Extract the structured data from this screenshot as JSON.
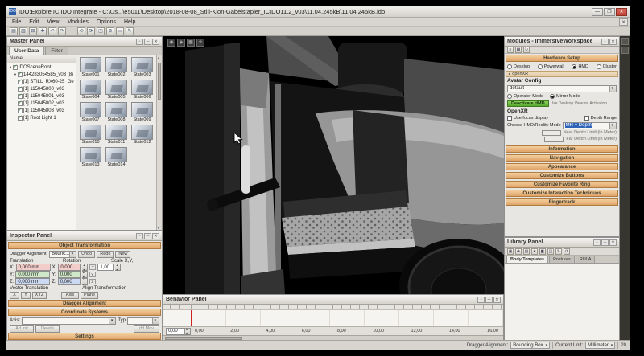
{
  "titlebar": {
    "app_icon": "IDO",
    "title": "IDO:Explore IC.IDO Integrate  -  C:\\Us...\\e5011\\Desktop\\2018-08-08_Still-Kion-Gabelstapler_ICIDO11.2_v03\\11.04.245kB\\11.04.245kB.ido",
    "window_buttons": [
      "—",
      "❐",
      "✕"
    ]
  },
  "menubar": {
    "items": [
      "File",
      "Edit",
      "View",
      "Modules",
      "Options",
      "Help"
    ]
  },
  "toolbar": {
    "icons": [
      "▤",
      "▥",
      "⊞",
      "✚",
      "↶",
      "↷",
      "⟲",
      "⟳",
      "◳",
      "⊕",
      "▭",
      "✎"
    ]
  },
  "master_panel": {
    "title": "Master Panel",
    "tabs": [
      "User Data",
      "Filter"
    ],
    "tree_header": "Name",
    "tree": [
      {
        "label": "IDOSceneRoot"
      },
      {
        "label": "144283054585_v03 (8)"
      },
      {
        "label": "[1] STILL_RX60-25_Ge"
      },
      {
        "label": "[1] 115045800_v03"
      },
      {
        "label": "[1] 115045801_v03"
      },
      {
        "label": "[1] 115045802_v03"
      },
      {
        "label": "[1] 115045803_v03"
      },
      {
        "label": "[1] Root Light 1"
      }
    ],
    "states": [
      "State001",
      "State002",
      "State003",
      "State004",
      "State005",
      "State006",
      "State007",
      "State008",
      "State009",
      "State010",
      "State011",
      "State012",
      "State013",
      "State014"
    ]
  },
  "inspector_panel": {
    "title": "Inspector Panel",
    "section_object_transformation": "Object Transformation",
    "dragger_alignment_label": "Dragger Alignment:",
    "dragger_alignment_value": "Bounc...",
    "undo": "Undo",
    "redo": "Redo",
    "new": "New",
    "translation_label": "Translation",
    "rotation_label": "Rotation",
    "scale_label": "Scale X,Y,",
    "axes": [
      "X:",
      "Y:",
      "Z:"
    ],
    "axis_letters": [
      "X",
      "Y",
      "Z"
    ],
    "translation_values": [
      "0,000 mm",
      "0,000 mm",
      "0,000 mm"
    ],
    "rotation_values": [
      "0,000",
      "0,000",
      "0,000"
    ],
    "scale_value": "1,00",
    "vector_translation_label": "Vector Translation",
    "align_transformation_label": "Align Transformation",
    "vector_buttons": [
      "X",
      "Y",
      "XYZ"
    ],
    "align_buttons": [
      "Axis",
      "Plane"
    ],
    "section_dragger_alignment": "Dragger Alignment",
    "section_coordinate_systems": "Coordinate Systems",
    "axis_label": "Axis:",
    "typ_label": "Typ",
    "buttons_bottom": [
      "Ad Inv",
      "Delete",
      "dd Mov"
    ],
    "section_settings": "Settings"
  },
  "viewport": {
    "tools": [
      "◉",
      "◈",
      "▦",
      "✛"
    ]
  },
  "behavior_panel": {
    "title": "Behavior Panel",
    "time_value": "0,00",
    "ticks": [
      "0,00",
      "2,00",
      "4,00",
      "6,00",
      "8,00",
      "10,00",
      "12,00",
      "14,00",
      "16,00"
    ]
  },
  "modules_panel": {
    "title": "Modules - ImmersiveWorkspace",
    "toolbar_icons": [
      "≡",
      "▦",
      "↻"
    ],
    "section_hardware_setup": "Hardware Setup",
    "hardware_options": [
      "Desktop",
      "Powerwall",
      "HMD",
      "Cluster"
    ],
    "hardware_selected": "HMD",
    "openxr_toggle": "openXR",
    "avatar_config_label": "Avatar Config",
    "avatar_value": "default",
    "mode_options": [
      "Operator Mode",
      "Mirror Mode"
    ],
    "mode_selected": "Mirror Mode",
    "deactivate_button": "Deactivate HMD",
    "desktop_view_label": "Use Desktop View on Activation",
    "openxr_label": "OpenXR",
    "focus_checkbox": "Use focus display",
    "depth_checkbox": "Depth Range",
    "reality_mode_label": "Choose HMD/Reality Mode",
    "reality_mode_value": "MR + Depth",
    "near_label": "Near Depth Limit (in Meter)",
    "far_label": "Far Depth Limit (in Meter)",
    "sections": [
      "Information",
      "Navigation",
      "Appearance",
      "Customize Buttons",
      "Customize Favorite Ring",
      "Customize Interaction Techniques",
      "Fingertrack"
    ]
  },
  "library_panel": {
    "title": "Library Panel",
    "toolbar_icons": [
      "▣",
      "✚",
      "▤",
      "★",
      "◧",
      "◫",
      "✎",
      "⟳"
    ],
    "tabs": [
      "Body Templates",
      "Postures",
      "RULA"
    ]
  },
  "statusbar": {
    "dragger_label": "Dragger Alignment:",
    "dragger_value": "Bounding Box",
    "unit_label": "Current Unit:",
    "unit_value": "Millimeter",
    "fps": "20"
  }
}
